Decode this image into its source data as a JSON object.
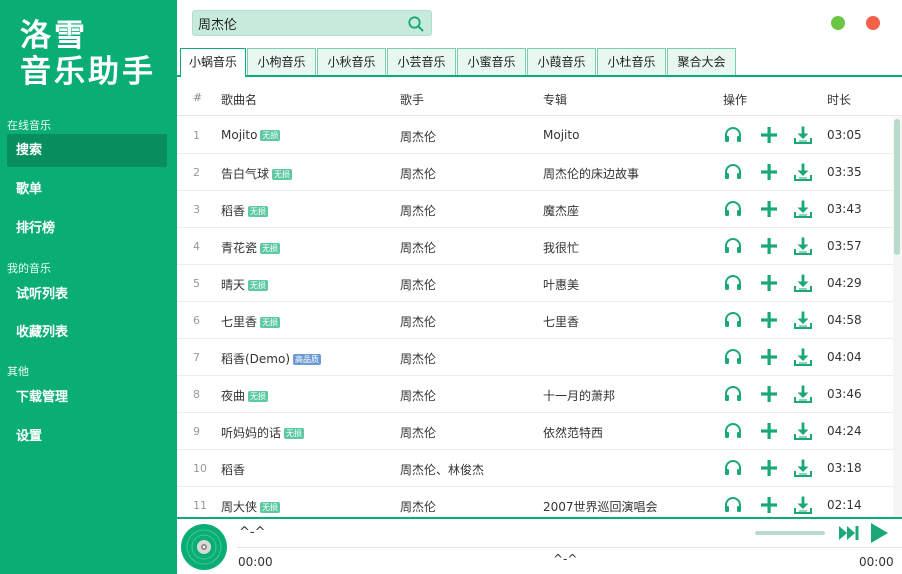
{
  "app": {
    "logo_line1": "洛雪",
    "logo_line2": "音乐助手"
  },
  "sidebar": {
    "sections": [
      {
        "title": "在线音乐",
        "items": [
          {
            "label": "搜索",
            "active": true
          },
          {
            "label": "歌单"
          },
          {
            "label": "排行榜"
          }
        ]
      },
      {
        "title": "我的音乐",
        "items": [
          {
            "label": "试听列表"
          },
          {
            "label": "收藏列表"
          }
        ]
      },
      {
        "title": "其他",
        "items": [
          {
            "label": "下载管理"
          },
          {
            "label": "设置"
          }
        ]
      }
    ]
  },
  "search": {
    "value": "周杰伦",
    "icon": "search-icon"
  },
  "window": {
    "min_color": "#6cc644",
    "close_color": "#f26149"
  },
  "tabs": [
    {
      "label": "小蜗音乐",
      "active": true
    },
    {
      "label": "小枸音乐"
    },
    {
      "label": "小秋音乐"
    },
    {
      "label": "小芸音乐"
    },
    {
      "label": "小蜜音乐"
    },
    {
      "label": "小葭音乐"
    },
    {
      "label": "小杜音乐"
    },
    {
      "label": "聚合大会"
    }
  ],
  "table": {
    "headers": {
      "index": "#",
      "name": "歌曲名",
      "artist": "歌手",
      "album": "专辑",
      "ops": "操作",
      "duration": "时长"
    },
    "rows": [
      {
        "index": "1",
        "name": "Mojito",
        "tag": "无损",
        "artist": "周杰伦",
        "album": "Mojito",
        "duration": "03:05"
      },
      {
        "index": "2",
        "name": "告白气球",
        "tag": "无损",
        "artist": "周杰伦",
        "album": "周杰伦的床边故事",
        "duration": "03:35"
      },
      {
        "index": "3",
        "name": "稻香",
        "tag": "无损",
        "artist": "周杰伦",
        "album": "魔杰座",
        "duration": "03:43"
      },
      {
        "index": "4",
        "name": "青花瓷",
        "tag": "无损",
        "artist": "周杰伦",
        "album": "我很忙",
        "duration": "03:57"
      },
      {
        "index": "5",
        "name": "晴天",
        "tag": "无损",
        "artist": "周杰伦",
        "album": "叶惠美",
        "duration": "04:29"
      },
      {
        "index": "6",
        "name": "七里香",
        "tag": "无损",
        "artist": "周杰伦",
        "album": "七里香",
        "duration": "04:58"
      },
      {
        "index": "7",
        "name": "稻香(Demo)",
        "tag": "高品质",
        "tag_type": "hq",
        "artist": "周杰伦",
        "album": "",
        "duration": "04:04"
      },
      {
        "index": "8",
        "name": "夜曲",
        "tag": "无损",
        "artist": "周杰伦",
        "album": "十一月的萧邦",
        "duration": "03:46"
      },
      {
        "index": "9",
        "name": "听妈妈的话",
        "tag": "无损",
        "artist": "周杰伦",
        "album": "依然范特西",
        "duration": "04:24"
      },
      {
        "index": "10",
        "name": "稻香",
        "tag": "",
        "artist": "周杰伦、林俊杰",
        "album": "",
        "duration": "03:18"
      },
      {
        "index": "11",
        "name": "周大侠",
        "tag": "无损",
        "artist": "周杰伦",
        "album": "2007世界巡回演唱会",
        "duration": "02:14"
      }
    ]
  },
  "player": {
    "title": "^-^",
    "center_text": "^-^",
    "time_current": "00:00",
    "time_total": "00:00"
  },
  "colors": {
    "accent": "#0aae74",
    "accent_dark": "#088e5f",
    "icon": "#1aa876"
  }
}
